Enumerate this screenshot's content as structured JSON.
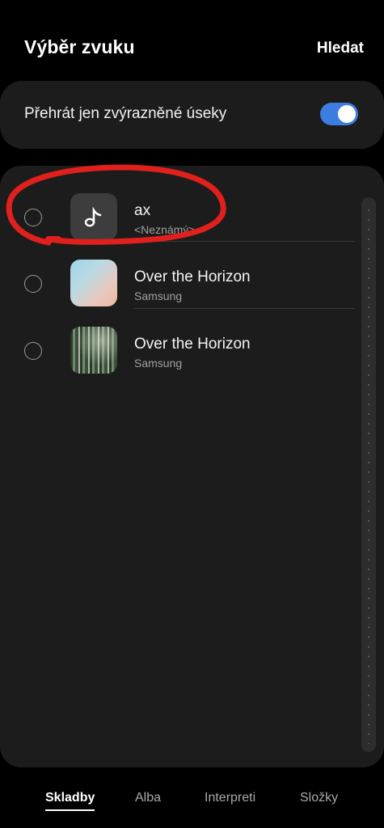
{
  "header": {
    "title": "Výběr zvuku",
    "search_label": "Hledat"
  },
  "toggle": {
    "label": "Přehrát jen zvýrazněné úseky",
    "state": "on",
    "color": "#3e7de0"
  },
  "tracks": [
    {
      "title": "ax",
      "artist": "<Neznámý>",
      "thumb_icon": "music-note-icon",
      "selected": false
    },
    {
      "title": "Over the Horizon",
      "artist": "Samsung",
      "selected": false
    },
    {
      "title": "Over the Horizon",
      "artist": "Samsung",
      "selected": false
    }
  ],
  "annotation": {
    "color": "#e0201c",
    "shape": "hand-drawn ellipse around first track"
  },
  "tabs": [
    {
      "label": "Skladby",
      "active": true
    },
    {
      "label": "Alba",
      "active": false
    },
    {
      "label": "Interpreti",
      "active": false
    },
    {
      "label": "Složky",
      "active": false
    }
  ]
}
